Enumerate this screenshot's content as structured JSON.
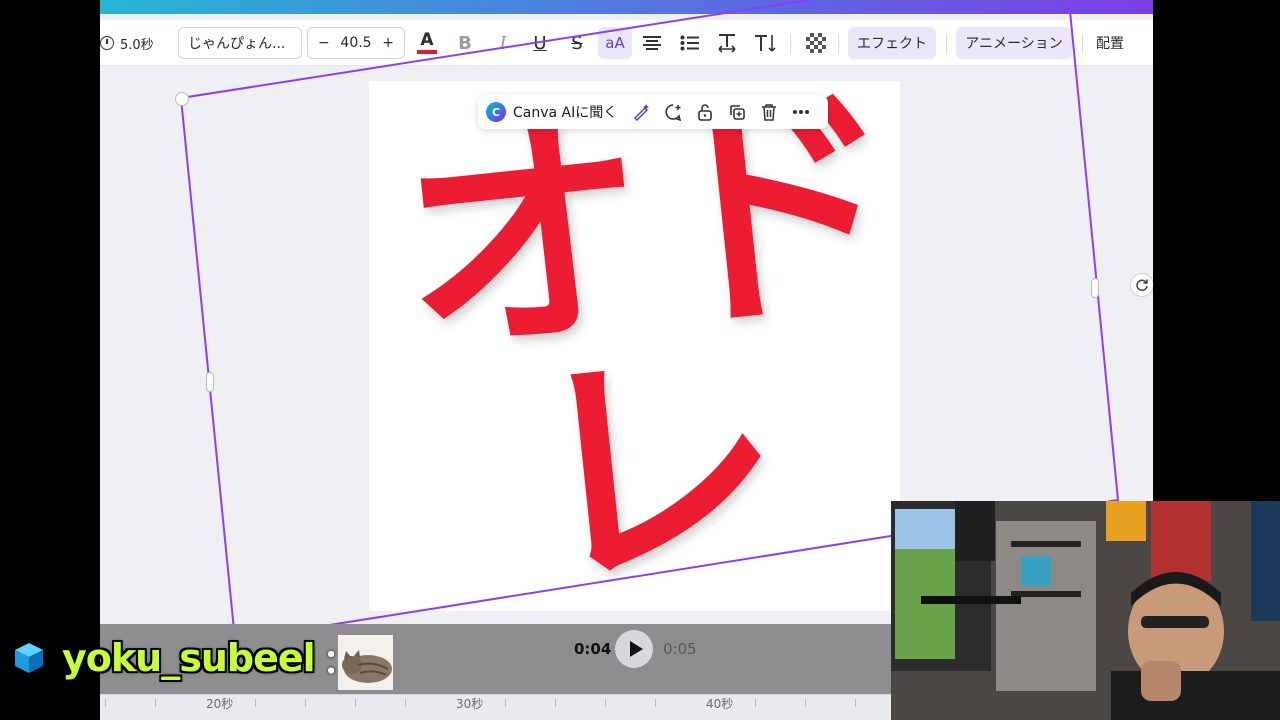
{
  "toolbar": {
    "duration": "5.0秒",
    "font_name": "じゃんぴょん...",
    "size_minus": "−",
    "font_size": "40.5",
    "size_plus": "+",
    "text_color_glyph": "A",
    "bold_glyph": "B",
    "italic_glyph": "I",
    "underline_glyph": "U",
    "strike_glyph": "S",
    "case_glyph": "aA",
    "effect_label": "エフェクト",
    "animation_label": "アニメーション",
    "layout_label": "配置",
    "text_color": "#e01b2e"
  },
  "float_bar": {
    "ai_label": "Canva AIに聞く"
  },
  "canvas": {
    "text_line1": "オド",
    "text_line2": "レ",
    "text_color": "#ec1c33"
  },
  "playback": {
    "current_time": "0:04",
    "total_time": "0:05"
  },
  "ruler": {
    "labels": [
      "20秒",
      "30秒",
      "40秒"
    ]
  },
  "overlay": {
    "username": "yoku_subeel",
    "separator": "："
  }
}
